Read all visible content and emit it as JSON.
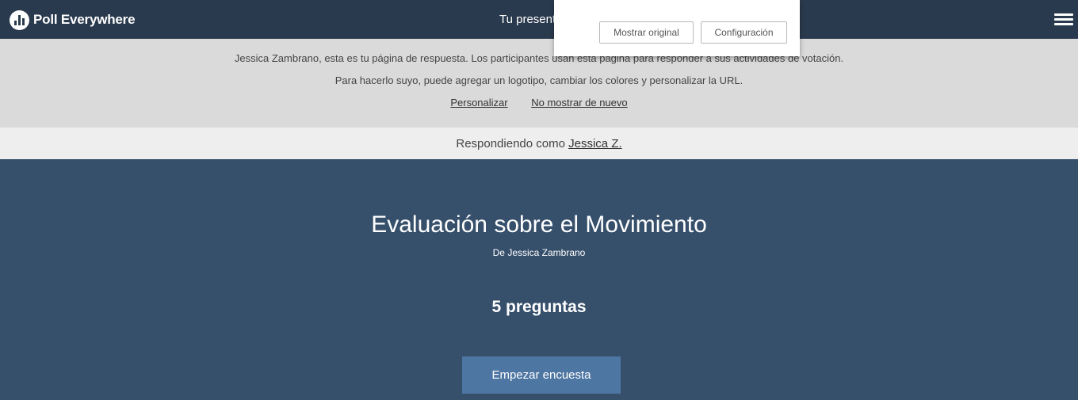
{
  "header": {
    "logo_text": "Poll Everywhere",
    "presenter_title": "Tu present",
    "menu_icon": "hamburger-menu-icon"
  },
  "translate_popup": {
    "show_original": "Mostrar original",
    "settings": "Configuración"
  },
  "notice": {
    "line1": "Jessica Zambrano, esta es tu página de respuesta. Los participantes usan esta página para responder a sus actividades de votación.",
    "line2": "Para hacerlo suyo, puede agregar un logotipo, cambiar los colores y personalizar la URL.",
    "customize_link": "Personalizar",
    "dont_show_link": "No mostrar de nuevo"
  },
  "responding": {
    "prefix": "Respondiendo como",
    "user_link": "Jessica Z."
  },
  "survey": {
    "title": "Evaluación sobre el Movimiento",
    "author": "De Jessica Zambrano",
    "question_count": "5 preguntas",
    "start_button": "Empezar encuesta"
  },
  "colors": {
    "topbar": "#2a3a4e",
    "main": "#364f6b",
    "button": "#4e76a3",
    "notice": "#dadada"
  }
}
